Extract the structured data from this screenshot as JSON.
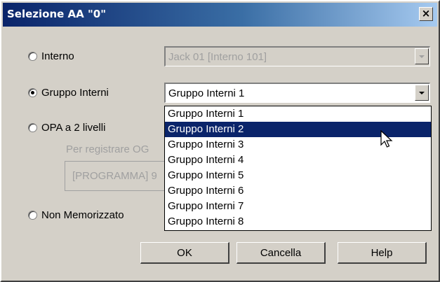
{
  "window": {
    "title": "Selezione AA \"0\"",
    "close_glyph": "×"
  },
  "options": {
    "interno": {
      "label": "Interno",
      "selected": false,
      "combo_value": "Jack 01 [Interno 101]",
      "combo_enabled": false
    },
    "gruppo": {
      "label": "Gruppo Interni",
      "selected": true,
      "combo_value": "Gruppo Interni 1",
      "combo_enabled": true
    },
    "opa": {
      "label": "OPA a 2 livelli",
      "selected": false,
      "hint": "Per registrare OG",
      "field_value": "[PROGRAMMA] 9"
    },
    "non_mem": {
      "label": "Non Memorizzato",
      "selected": false
    }
  },
  "dropdown": {
    "items": [
      "Gruppo Interni 1",
      "Gruppo Interni 2",
      "Gruppo Interni 3",
      "Gruppo Interni 4",
      "Gruppo Interni 5",
      "Gruppo Interni 6",
      "Gruppo Interni 7",
      "Gruppo Interni 8"
    ],
    "highlighted_index": 1
  },
  "buttons": {
    "ok": "OK",
    "cancel": "Cancella",
    "help": "Help"
  },
  "colors": {
    "title_gradient_start": "#0a246a",
    "title_gradient_end": "#a6caf0",
    "selection": "#0a246a",
    "face": "#d4d0c8"
  },
  "icons": {
    "cursor": "arrow-cursor-icon",
    "combo_arrow": "chevron-down-icon",
    "close": "close-icon"
  }
}
